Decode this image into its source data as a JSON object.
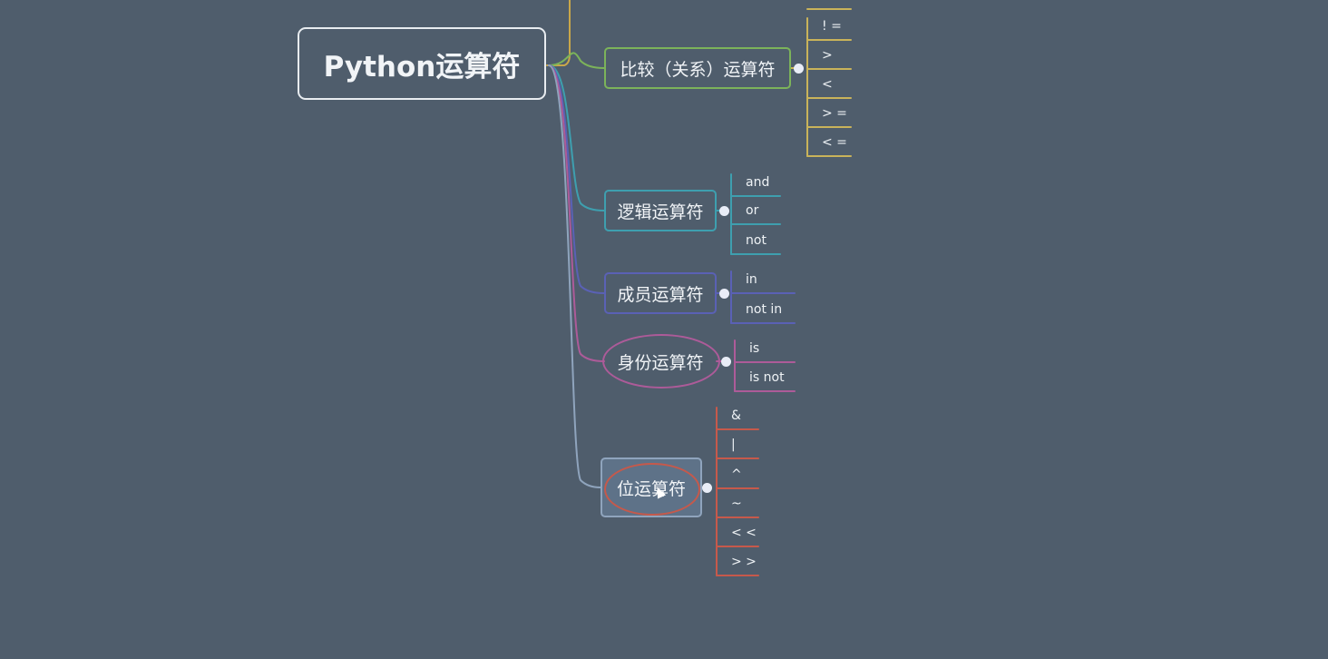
{
  "root": {
    "label": "Python运算符",
    "border": "#e8ecf0"
  },
  "categories": [
    {
      "label": "比较（关系）运算符",
      "color": "#7cb35a",
      "leafColor": "#c9b35a",
      "leaves": [
        "! =",
        ">",
        "<",
        "> =",
        "< ="
      ]
    },
    {
      "label": "逻辑运算符",
      "color": "#3e9faf",
      "leafColor": "#3e9faf",
      "leaves": [
        "and",
        "or",
        "not"
      ]
    },
    {
      "label": "成员运算符",
      "color": "#5a61b5",
      "leafColor": "#5a61b5",
      "leaves": [
        "in",
        "not in"
      ]
    },
    {
      "label": "身份运算符",
      "color": "#ad5b99",
      "leafColor": "#ad5b99",
      "leaves": [
        "is",
        "is not"
      ]
    },
    {
      "label": "位运算符",
      "color": "#8fa4bd",
      "leafColor": "#c6594b",
      "leaves": [
        "&",
        "|",
        "^",
        "~",
        "< <",
        "> >"
      ]
    }
  ],
  "colors": {
    "background": "#4f5d6c",
    "trunk": "#c9a74a",
    "dot": "#e9edf7"
  }
}
